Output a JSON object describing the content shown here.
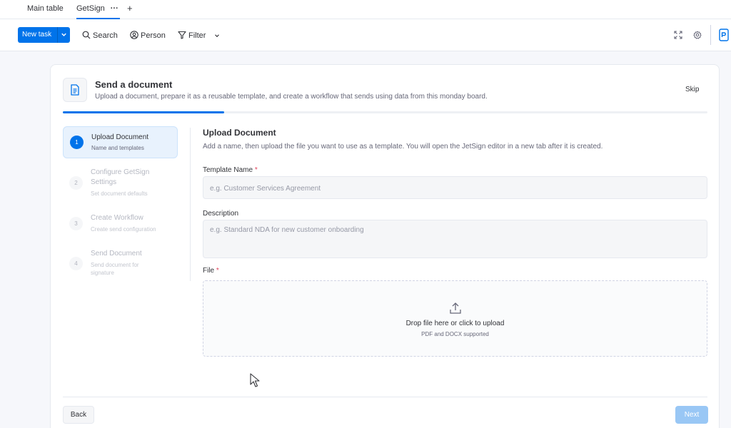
{
  "tabs": [
    {
      "label": "Main table"
    },
    {
      "label": "GetSign",
      "more": "···"
    }
  ],
  "tab_add": "+",
  "toolbar": {
    "new_task": "New task",
    "search": "Search",
    "person": "Person",
    "filter": "Filter"
  },
  "header": {
    "title": "Send a document",
    "subtitle": "Upload a document, prepare it as a reusable template, and create a workflow that sends using data from this monday board.",
    "skip": "Skip"
  },
  "progress": 0.25,
  "steps": [
    {
      "num": "1",
      "title": "Upload Document",
      "sub": "Name and templates",
      "active": true
    },
    {
      "num": "2",
      "title": "Configure GetSign Settings",
      "sub": "Set document defaults",
      "active": false
    },
    {
      "num": "3",
      "title": "Create Workflow",
      "sub": "Create send configuration",
      "active": false
    },
    {
      "num": "4",
      "title": "Send Document",
      "sub": "Send document for signature",
      "active": false
    }
  ],
  "form": {
    "title": "Upload Document",
    "description": "Add a name, then upload the file you want to use as a template. You will open the JetSign editor in a new tab after it is created.",
    "template_name_label": "Template Name",
    "template_name_placeholder": "e.g. Customer Services Agreement",
    "description_label": "Description",
    "description_placeholder": "e.g. Standard NDA for new customer onboarding",
    "file_label": "File",
    "required_mark": "*",
    "drop_text": "Drop file here or click to upload",
    "drop_sub": "PDF and DOCX supported"
  },
  "buttons": {
    "back": "Back",
    "next": "Next"
  },
  "colors": {
    "primary": "#0073ea",
    "required": "#e2445c",
    "next_disabled": "#99c7f5"
  }
}
